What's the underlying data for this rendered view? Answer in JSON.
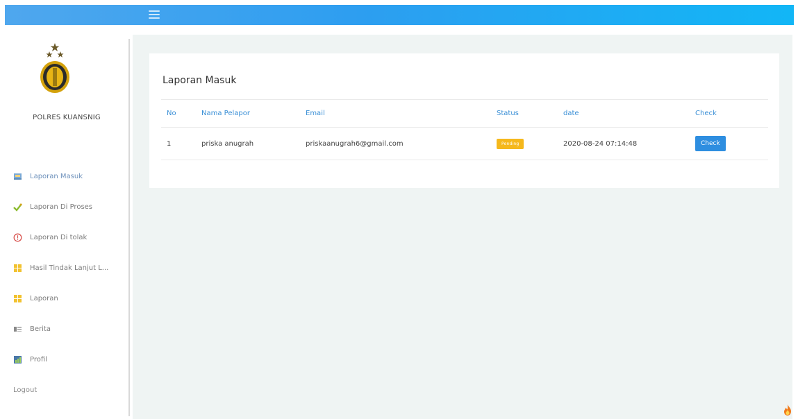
{
  "topbar": {
    "menu_icon": "hamburger-icon",
    "colors": [
      "#4fa7ee",
      "#12b6f6"
    ]
  },
  "sidebar": {
    "brand": "POLRES KUANSNIG",
    "logo_icon": "police-emblem-icon",
    "items": [
      {
        "label": "Laporan Masuk",
        "icon": "inbox-icon",
        "active": true
      },
      {
        "label": "Laporan Di Proses",
        "icon": "check-icon",
        "active": false
      },
      {
        "label": "Laporan Di tolak",
        "icon": "alert-circle-icon",
        "active": false
      },
      {
        "label": "Hasil Tindak Lanjut L...",
        "icon": "grid-icon",
        "active": false
      },
      {
        "label": "Laporan",
        "icon": "grid-icon",
        "active": false
      },
      {
        "label": "Berita",
        "icon": "news-icon",
        "active": false
      },
      {
        "label": "Profil",
        "icon": "chart-icon",
        "active": false
      }
    ],
    "logout": "Logout"
  },
  "main": {
    "title": "Laporan Masuk",
    "table": {
      "headers": [
        "No",
        "Nama Pelapor",
        "Email",
        "Status",
        "date",
        "Check"
      ],
      "rows": [
        {
          "no": "1",
          "name": "priska anugrah",
          "email": "priskaanugrah6@gmail.com",
          "status": "Pending",
          "date": "2020-08-24 07:14:48",
          "action": "Check"
        }
      ]
    }
  },
  "colors": {
    "accent": "#2e8ee0",
    "pending": "#f5b81c",
    "header_text": "#3a8fd6",
    "background": "#eff4f3"
  },
  "corner_icon": "flame-icon"
}
